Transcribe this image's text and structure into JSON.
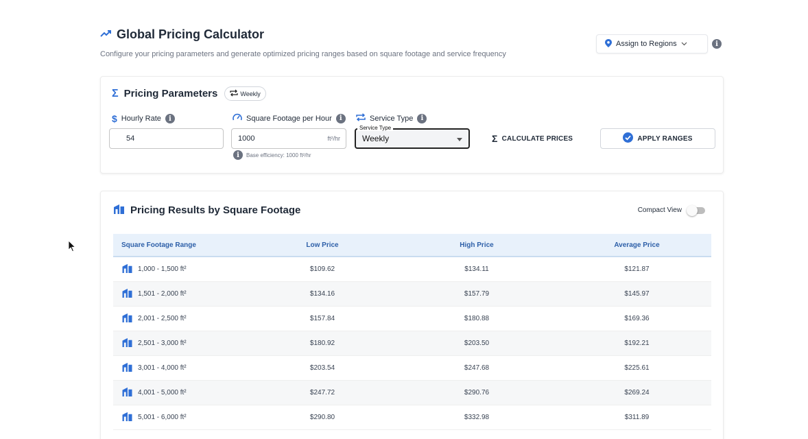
{
  "header": {
    "title": "Global Pricing Calculator",
    "subtitle": "Configure your pricing parameters and generate optimized pricing ranges based on square footage and service frequency",
    "assign_label": "Assign to Regions"
  },
  "params": {
    "title": "Pricing Parameters",
    "frequency_chip": "Weekly",
    "hourly_rate": {
      "label": "Hourly Rate",
      "value": "54"
    },
    "sqft_per_hour": {
      "label": "Square Footage per Hour",
      "value": "1000",
      "unit": "ft²/hr",
      "helper": "Base efficiency: 1000 ft²/hr"
    },
    "service_type": {
      "label": "Service Type",
      "legend": "Service Type",
      "value": "Weekly"
    },
    "calculate_label": "CALCULATE PRICES",
    "apply_label": "APPLY RANGES"
  },
  "results": {
    "title": "Pricing Results by Square Footage",
    "compact_label": "Compact View",
    "compact_on": false,
    "columns": [
      "Square Footage Range",
      "Low Price",
      "High Price",
      "Average Price"
    ],
    "rows": [
      [
        "1,000 - 1,500 ft²",
        "$109.62",
        "$134.11",
        "$121.87"
      ],
      [
        "1,501 - 2,000 ft²",
        "$134.16",
        "$157.79",
        "$145.97"
      ],
      [
        "2,001 - 2,500 ft²",
        "$157.84",
        "$180.88",
        "$169.36"
      ],
      [
        "2,501 - 3,000 ft²",
        "$180.92",
        "$203.50",
        "$192.21"
      ],
      [
        "3,001 - 4,000 ft²",
        "$203.54",
        "$247.68",
        "$225.61"
      ],
      [
        "4,001 - 5,000 ft²",
        "$247.72",
        "$290.76",
        "$269.24"
      ],
      [
        "5,001 - 6,000 ft²",
        "$290.80",
        "$332.98",
        "$311.89"
      ]
    ]
  },
  "colors": {
    "accent": "#2d5fa8",
    "icon_blue": "#2f6fd6",
    "header_bg": "#e8f1fb"
  }
}
